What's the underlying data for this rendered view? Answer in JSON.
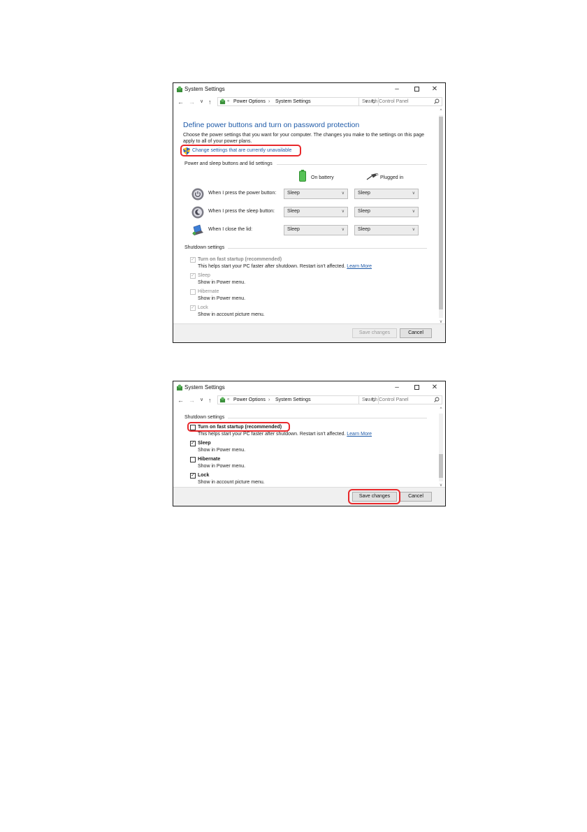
{
  "colors": {
    "heading_blue": "#1e5aa8",
    "highlight_red": "#e8282b",
    "link_blue": "#1e5aa8"
  },
  "window1": {
    "title": "System Settings",
    "icons": {
      "app": "control-panel-icon",
      "minimize": "minimize-icon",
      "maximize": "maximize-icon",
      "close": "close-icon"
    },
    "controls": {
      "minimize": "–",
      "maximize": "",
      "close": "✕"
    },
    "nav": {
      "back": "←",
      "forward": "→",
      "recent": "∨",
      "up": "↑"
    },
    "address": {
      "overflow": "«",
      "crumb1": "Power Options",
      "separator": "›",
      "crumb2": "System Settings",
      "dropdown": "∨",
      "refresh": "↻"
    },
    "search": {
      "placeholder": "Search Control Panel",
      "icon": "search-icon"
    },
    "heading": "Define power buttons and turn on password protection",
    "description": "Choose the power settings that you want for your computer. The changes you make to the settings on this page apply to all of your power plans.",
    "change_link": "Change settings that are currently unavailable",
    "power_section": {
      "title": "Power and sleep buttons and lid settings",
      "col_battery": "On battery",
      "col_plugged": "Plugged in",
      "rows": [
        {
          "label": "When I press the power button:",
          "icon": "power-button-icon",
          "battery": "Sleep",
          "plugged": "Sleep"
        },
        {
          "label": "When I press the sleep button:",
          "icon": "sleep-button-icon",
          "battery": "Sleep",
          "plugged": "Sleep"
        },
        {
          "label": "When I close the lid:",
          "icon": "laptop-lid-icon",
          "battery": "Sleep",
          "plugged": "Sleep"
        }
      ]
    },
    "shutdown_section": {
      "title": "Shutdown settings",
      "items": [
        {
          "label": "Turn on fast startup (recommended)",
          "checked": true,
          "sub": "This helps start your PC faster after shutdown. Restart isn't affected.",
          "link": "Learn More"
        },
        {
          "label": "Sleep",
          "checked": true,
          "sub": "Show in Power menu."
        },
        {
          "label": "Hibernate",
          "checked": false,
          "sub": "Show in Power menu."
        },
        {
          "label": "Lock",
          "checked": true,
          "sub": "Show in account picture menu."
        }
      ]
    },
    "buttons": {
      "save": "Save changes",
      "cancel": "Cancel"
    },
    "scroll": {
      "up": "^",
      "down": "v"
    }
  },
  "window2": {
    "title": "System Settings",
    "controls": {
      "minimize": "–",
      "maximize": "",
      "close": "✕"
    },
    "nav": {
      "back": "←",
      "forward": "→",
      "recent": "∨",
      "up": "↑"
    },
    "address": {
      "overflow": "«",
      "crumb1": "Power Options",
      "separator": "›",
      "crumb2": "System Settings",
      "dropdown": "∨",
      "refresh": "↻"
    },
    "search": {
      "placeholder": "Search Control Panel"
    },
    "shutdown_section": {
      "title": "Shutdown settings",
      "items": [
        {
          "label": "Turn on fast startup (recommended)",
          "checked": false,
          "sub": "This helps start your PC faster after shutdown. Restart isn't affected.",
          "link": "Learn More"
        },
        {
          "label": "Sleep",
          "checked": true,
          "sub": "Show in Power menu."
        },
        {
          "label": "Hibernate",
          "checked": false,
          "sub": "Show in Power menu."
        },
        {
          "label": "Lock",
          "checked": true,
          "sub": "Show in account picture menu."
        }
      ]
    },
    "buttons": {
      "save": "Save changes",
      "cancel": "Cancel"
    },
    "scroll": {
      "up": "^",
      "down": "v"
    }
  }
}
